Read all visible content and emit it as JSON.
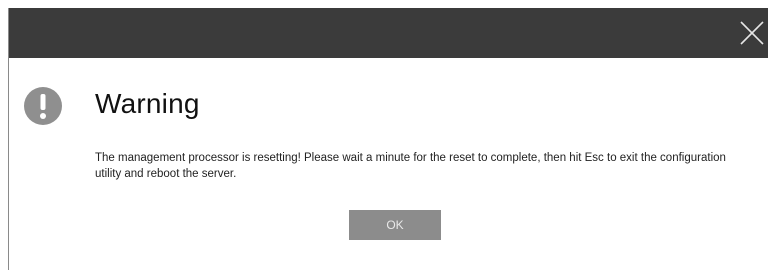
{
  "dialog": {
    "title": "Warning",
    "message": "The management processor is resetting! Please wait a minute for the reset to complete, then hit Esc to exit the configuration utility and reboot the server.",
    "ok_label": "OK"
  },
  "icons": {
    "warning": "warning-icon",
    "close": "close-icon"
  },
  "colors": {
    "title_bar": "#3b3b3b",
    "warning_icon": "#8f8f8f",
    "button": "#8c8c8c"
  }
}
